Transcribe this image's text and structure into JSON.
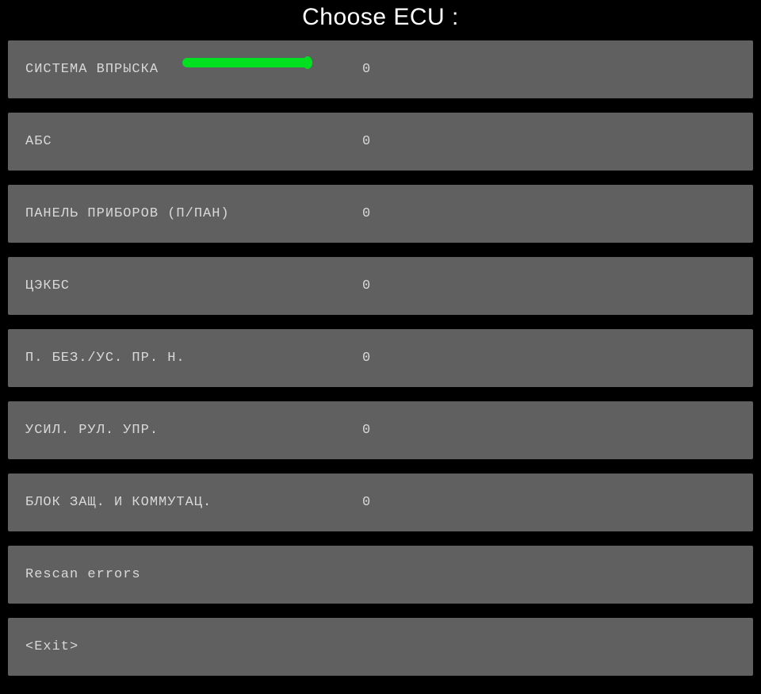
{
  "title": "Choose ECU :",
  "ecus": [
    {
      "label": "СИСТЕМА ВПРЫСКА",
      "value": "0"
    },
    {
      "label": "АБС",
      "value": "0"
    },
    {
      "label": "ПАНЕЛЬ ПРИБОРОВ (П/ПАН)",
      "value": "0"
    },
    {
      "label": "ЦЭКБС",
      "value": "0"
    },
    {
      "label": "П. БЕЗ./УС. ПР. Н.",
      "value": "0"
    },
    {
      "label": "УСИЛ. РУЛ. УПР.",
      "value": "0"
    },
    {
      "label": "БЛОК ЗАЩ. И КОММУТАЦ.",
      "value": "0"
    }
  ],
  "actions": {
    "rescan": "Rescan errors",
    "exit": "<Exit>"
  },
  "highlight_color": "#00e020"
}
